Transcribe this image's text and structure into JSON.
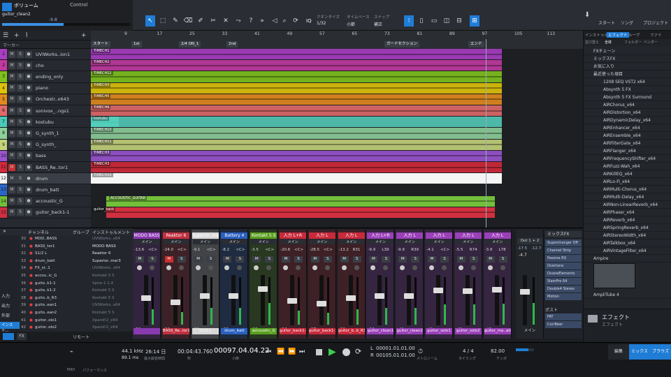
{
  "header": {
    "volume_label": "ボリューム",
    "channel_name": "guitor_clean2",
    "volume_value": "-9.8",
    "control_label": "Control",
    "quantize_label": "クオンタイズ",
    "quantize_value": "1/32",
    "timebase_label": "タイムベース",
    "timebase_value": "小節",
    "snap_label": "スナップ",
    "snap_value": "補正",
    "iq_label": "IQ",
    "start_label": "スタート",
    "song_label": "ソング",
    "project_label": "プロジェクト"
  },
  "arrange": {
    "marker_label": "マーカー",
    "ruler_numbers": [
      "9",
      "17",
      "25",
      "33",
      "41",
      "49",
      "57",
      "65",
      "73",
      "81",
      "89",
      "97",
      "105",
      "113"
    ],
    "markers": [
      "スタート",
      "1st",
      "2/4 ON_1",
      "2nd",
      "ガードセクション",
      "エンド"
    ],
    "tracks": [
      {
        "num": "1",
        "name": "UVIWorks..ion1",
        "color": "#a83ec2"
      },
      {
        "num": "2",
        "name": "cho",
        "color": "#c03aa0"
      },
      {
        "num": "3",
        "name": "ending_only",
        "color": "#7fc21e"
      },
      {
        "num": "4",
        "name": "piano",
        "color": "#e0c20a"
      },
      {
        "num": "5",
        "name": "Orchestr..x643",
        "color": "#e38a1e"
      },
      {
        "num": "6",
        "name": "sonivox_..ngs1",
        "color": "#e06a6a"
      },
      {
        "num": "7",
        "name": "kostubu",
        "color": "#4bc9b8"
      },
      {
        "num": "8",
        "name": "G_synth_1",
        "color": "#8ecf9a"
      },
      {
        "num": "9",
        "name": "G_synth_",
        "color": "#c4d27a"
      },
      {
        "num": "10",
        "name": "bass",
        "color": "#9a55d0"
      },
      {
        "num": "11",
        "name": "BASS_Re..tor1",
        "color": "#d22a3a"
      },
      {
        "num": "12",
        "name": "drum",
        "color": "#f2f2f2"
      },
      {
        "num": "13",
        "name": "drum_batt",
        "color": "#2a66c8"
      },
      {
        "num": "14",
        "name": "accoustic_G",
        "color": "#72c03a"
      },
      {
        "num": "15",
        "name": "guitor_back1-1",
        "color": "#d23040"
      }
    ],
    "clip_labels": [
      "TIMECH1",
      "TIMECH2",
      "TIMECH12",
      "TIMECH3",
      "TIMECH5",
      "TIMECH6",
      "kostubu",
      "TIMECH10",
      "TIMECH11",
      "TIMECH3",
      "TIMECH3",
      "TIMECH10",
      "ACCOUSTIC_GUITAR",
      "guitor_back"
    ]
  },
  "browser": {
    "tabs": [
      "インストゥルメント",
      "エフェクト",
      "ループ",
      "ファイ"
    ],
    "subtabs": [
      "並び替え",
      "全体",
      "フォルダー",
      "ベンダー"
    ],
    "categories": [
      "FXチェーン",
      "ミックスFX",
      "お気に入り",
      "最近使った項目"
    ],
    "effects": [
      "1208 SEQ VST2 x64",
      "Absynth 5 FX",
      "Absynth 5 FX Surround",
      "AIRChorus_x64",
      "AIRDistortion_x64",
      "AIRDynamicDelay_x64",
      "AIREnhancer_x64",
      "AIREnsemble_x64",
      "AIRFilterGate_x64",
      "AIRFlanger_x64",
      "AIRFrequencyShifter_x64",
      "AIRFuzz-Wah_x64",
      "AIRKillEQ_x64",
      "AIRLo-Fi_x64",
      "AIRMulti-Chorus_x64",
      "AIRMulti-Delay_x64",
      "AIRNon-LinearReverb_x64",
      "AIRPhaser_x64",
      "AIRReverb_x64",
      "AIRSpringReverb_x64",
      "AIRStereoWidth_x64",
      "AIRTalkbox_x64",
      "AIRVintageFilter_x64"
    ],
    "fx_group": "Ampire",
    "amplitube": "AmpliTube 4",
    "footer_title": "エフェクト",
    "footer_sub": "エフェクト"
  },
  "mixer": {
    "channel_header": "チャンネル",
    "group_header": "グループ",
    "instrument_header": "インストゥルメント",
    "inputs_label": "入力",
    "outputs_label": "出力",
    "external_label": "外部",
    "instrument_label": "インスト...",
    "remote_label": "リモート",
    "list": [
      {
        "num": "30",
        "name": "MOD..BASS"
      },
      {
        "num": "31",
        "name": "BASS_tor1"
      },
      {
        "num": "32",
        "name": "S1/2 L"
      },
      {
        "num": "33",
        "name": "drum_batt"
      },
      {
        "num": "34",
        "name": "FX_st..1"
      },
      {
        "num": "35",
        "name": "accou..ic_G"
      },
      {
        "num": "36",
        "name": "guito..k1-1"
      },
      {
        "num": "37",
        "name": "guito..k1-2"
      },
      {
        "num": "38",
        "name": "guito..b_R3"
      },
      {
        "num": "39",
        "name": "guito..ean1"
      },
      {
        "num": "40",
        "name": "guito..ean2"
      },
      {
        "num": "41",
        "name": "guitor..olo1"
      },
      {
        "num": "42",
        "name": "guitor..olo2"
      }
    ],
    "instruments": [
      "UVIWorks..x64",
      "MODO BASS",
      "Reaktor 6",
      "Superior..mer3",
      "UVIWorks..x64",
      "Kontakt 5 S",
      "Spire-1.1.4",
      "Kontakt 5 S",
      "Kontakt 5 S",
      "UVIWorks..x64",
      "Kontakt 5 S",
      "Xpand!2_x64",
      "Xpand!2_x64"
    ],
    "channels": [
      {
        "name": "MODO BASS",
        "pan": "<C>",
        "vol": "-13.6",
        "num": "30",
        "foot": "",
        "color": "#8a3ab0",
        "fader": 0.55
      },
      {
        "name": "Reaktor 6",
        "pan": "<C>",
        "vol": "-24.0",
        "num": "31",
        "foot": "BASS_Re..tor1",
        "color": "#c03040",
        "fader": 0.45
      },
      {
        "name": "Superior..mer3",
        "pan": "<C>",
        "vol": "-9.1",
        "num": "32",
        "foot": "S1/2 L",
        "color": "#d8d8d8",
        "fader": 0.6
      },
      {
        "name": "Battery 4",
        "pan": "<C>",
        "vol": "-8.2",
        "num": "33",
        "foot": "drum_batt",
        "color": "#2a60c0",
        "fader": 0.6
      },
      {
        "name": "Kontakt 5 S",
        "pan": "<C>",
        "vol": "-3.5",
        "num": "35",
        "foot": "accoustic_G",
        "color": "#5aa020",
        "fader": 0.75
      },
      {
        "name": "入力 L+R",
        "pan": "<C>",
        "vol": "-20.6",
        "num": "36",
        "foot": "guitor_back1-1",
        "color": "#c82a3c",
        "fader": 0.48
      },
      {
        "name": "入力 L",
        "pan": "<C>",
        "vol": "-28.5",
        "num": "37",
        "foot": "guitor_back1-2",
        "color": "#c82a3c",
        "fader": 0.42
      },
      {
        "name": "入力 L",
        "pan": "R31",
        "vol": "-13.2",
        "num": "38",
        "foot": "guitor_b..b_R3",
        "color": "#c82a3c",
        "fader": 0.55
      },
      {
        "name": "入力 L+R",
        "pan": "L39",
        "vol": "-9.9",
        "num": "39",
        "foot": "guitor_clean1",
        "color": "#9a40b8",
        "fader": 0.6
      },
      {
        "name": "入力 L",
        "pan": "R39",
        "vol": "-9.9",
        "num": "40",
        "foot": "guitor_clean2",
        "color": "#9a40b8",
        "fader": 0.6
      },
      {
        "name": "入力 L",
        "pan": "<C>",
        "vol": "-4.1",
        "num": "41",
        "foot": "guitor_solo1",
        "color": "#9a40b8",
        "fader": 0.72
      },
      {
        "name": "入力 L",
        "pan": "R74",
        "vol": "-5.5",
        "num": "42",
        "foot": "guitor_solo2",
        "color": "#9a40b8",
        "fader": 0.7
      },
      {
        "name": "入力 L",
        "pan": "L78",
        "vol": "-3.9",
        "num": "43",
        "foot": "guitor_ma..ald1",
        "color": "#9a40b8",
        "fader": 0.74
      }
    ],
    "main_label": "Out 1 + 2",
    "main_values": [
      "-17.5",
      "-12.7"
    ],
    "main_vol": "-4.7",
    "main_foot": "メイン",
    "meinlabel": "メイン",
    "mixfx_label": "ミックスFX",
    "mixfx_items": [
      "Superchanger Off",
      "Channel Strip",
      "Passive EQ",
      "Overtone",
      "OvaneElements",
      "SlamPro 64",
      "Double4 Stereo",
      "Motion"
    ],
    "post_label": "ポスト",
    "post_items": [
      "FAT",
      "CorrBeer"
    ]
  },
  "transport": {
    "midi_label": "MIDI",
    "perf_label": "パフォーマンス",
    "sample_rate": "44.1 kHz",
    "latency": "89.1 ms",
    "time_rec": "26:14 日",
    "max_rec": "最大録音時間",
    "time_display": "00:04:43.760",
    "seconds_label": "秒",
    "bar_display": "00097.04.04.22",
    "bar_label": "小節",
    "loop_start": "00001.01.01.00",
    "loop_end": "00105.01.01.00",
    "signature": "4 / 4",
    "metro_label": "メトロノーム",
    "timing_label": "タイミング",
    "tempo": "82.00",
    "tempo_label": "テンポ",
    "edit_tab": "編集",
    "mix_tab": "ミックス",
    "browse_tab": "ブラウズ"
  }
}
